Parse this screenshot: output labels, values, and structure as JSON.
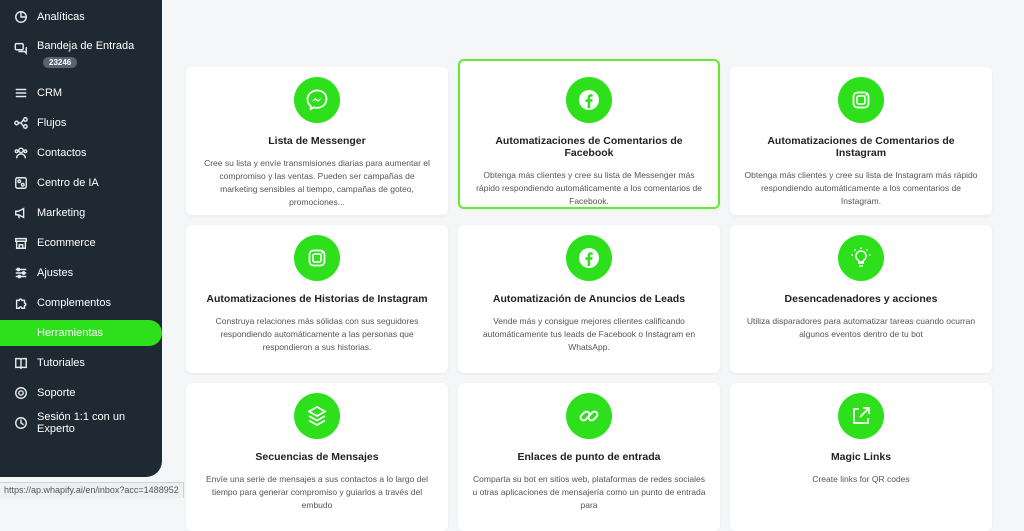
{
  "sidebar": {
    "items": [
      {
        "label": "Analíticas",
        "icon": "analytics-icon"
      },
      {
        "label": "Bandeja de Entrada",
        "icon": "chat-icon",
        "badge": "23246"
      },
      {
        "label": "CRM",
        "icon": "list-icon"
      },
      {
        "label": "Flujos",
        "icon": "flow-icon"
      },
      {
        "label": "Contactos",
        "icon": "contacts-icon"
      },
      {
        "label": "Centro de IA",
        "icon": "ai-icon"
      },
      {
        "label": "Marketing",
        "icon": "megaphone-icon"
      },
      {
        "label": "Ecommerce",
        "icon": "store-icon"
      },
      {
        "label": "Ajustes",
        "icon": "sliders-icon"
      },
      {
        "label": "Complementos",
        "icon": "puzzle-icon"
      },
      {
        "label": "Herramientas",
        "icon": "tools-icon",
        "active": true
      },
      {
        "label": "Tutoriales",
        "icon": "book-icon"
      },
      {
        "label": "Soporte",
        "icon": "support-icon"
      },
      {
        "label": "Sesión 1:1 con un Experto",
        "icon": "expert-icon"
      }
    ]
  },
  "status_url": "https://ap.whapify.ai/en/inbox?acc=1488952",
  "accent_color": "#2ee01c",
  "cards": [
    {
      "title": "Lista de Messenger",
      "icon": "messenger-icon",
      "desc": "Cree su lista y envíe transmisiones diarias para aumentar el compromiso y las ventas. Pueden ser campañas de marketing sensibles al tiempo, campañas de goteo, promociones..."
    },
    {
      "title": "Automatizaciones de Comentarios de Facebook",
      "icon": "facebook-icon",
      "desc": "Obtenga más clientes y cree su lista de Messenger más rápido respondiendo automáticamente a los comentarios de Facebook.",
      "selected": true
    },
    {
      "title": "Automatizaciones de Comentarios de Instagram",
      "icon": "instagram-icon",
      "desc": "Obtenga más clientes y cree su lista de Instagram más rápido respondiendo automáticamente a los comentarios de Instagram."
    },
    {
      "title": "Automatizaciones de Historias de Instagram",
      "icon": "instagram-icon",
      "desc": "Construya relaciones más sólidas con sus seguidores respondiendo automáticamente a las personas que respondieron a sus historias."
    },
    {
      "title": "Automatización de Anuncios de Leads",
      "icon": "facebook-icon",
      "desc": "Vende más y consigue mejores clientes calificando automáticamente tus leads de Facebook o Instagram en WhatsApp."
    },
    {
      "title": "Desencadenadores y acciones",
      "icon": "lightbulb-icon",
      "desc": "Utiliza disparadores para automatizar tareas cuando ocurran algunos eventos dentro de tu bot"
    },
    {
      "title": "Secuencias de Mensajes",
      "icon": "layers-icon",
      "desc": "Envíe una serie de mensajes a sus contactos a lo largo del tiempo para generar compromiso y guiarlos a través del embudo"
    },
    {
      "title": "Enlaces de punto de entrada",
      "icon": "link-icon",
      "desc": "Comparta su bot en sitios web, plataformas de redes sociales u otras aplicaciones de mensajería como un punto de entrada para"
    },
    {
      "title": "Magic Links",
      "icon": "external-link-icon",
      "desc": "Create links for QR codes"
    }
  ]
}
